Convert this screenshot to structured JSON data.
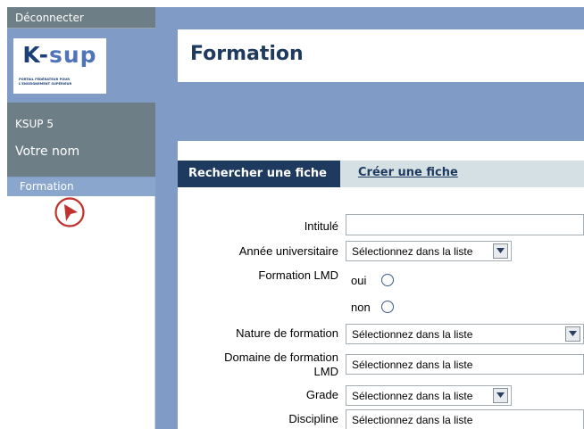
{
  "sidebar": {
    "logout_label": "Déconnecter",
    "logo": {
      "brand_k": "K-",
      "brand_sup": "sup",
      "tagline": "Portail fédérateur pour l'enseignement supérieur"
    },
    "site_name": "KSUP 5",
    "user_name": "Votre nom",
    "nav_item": "Formation",
    "cursor_icon": "arrow-pointer-circle-icon"
  },
  "header": {
    "title": "Formation"
  },
  "tabs": {
    "active": "Rechercher une fiche",
    "other": "Créer une fiche"
  },
  "form": {
    "intitule": {
      "label": "Intitulé",
      "value": ""
    },
    "annee": {
      "label": "Année universitaire",
      "value": "Sélectionnez dans la liste"
    },
    "lmd": {
      "label": "Formation LMD",
      "options": [
        "oui",
        "non"
      ],
      "selected": null
    },
    "nature": {
      "label": "Nature de formation",
      "value": "Sélectionnez dans la liste"
    },
    "domaine": {
      "label_line1": "Domaine de formation",
      "label_line2": "LMD",
      "value": "Sélectionnez dans la liste"
    },
    "grade": {
      "label": "Grade",
      "value": "Sélectionnez dans la liste"
    },
    "discipline": {
      "label": "Discipline",
      "value": "Sélectionnez dans la liste"
    }
  },
  "colors": {
    "frame": "#7f9bc6",
    "sidebar_dark": "#6e7e86",
    "accent": "#1f3a5f",
    "tab_bar": "#d5e0e4",
    "cursor": "#c0302c"
  }
}
